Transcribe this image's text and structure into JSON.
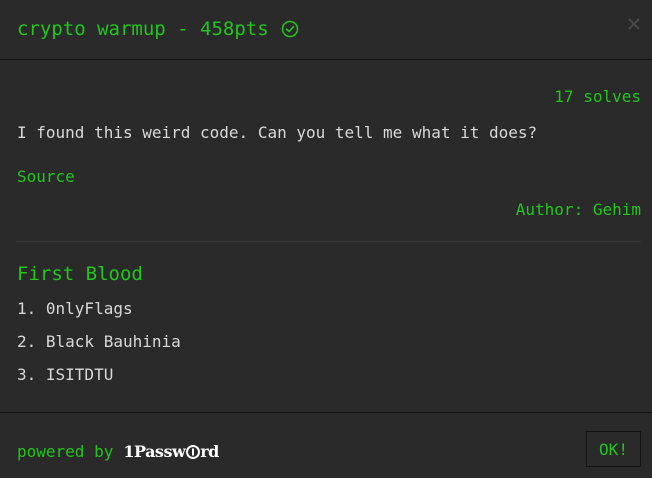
{
  "header": {
    "title": "crypto warmup - 458pts",
    "solved_icon": "check-circle-icon",
    "close_icon": "close-icon"
  },
  "body": {
    "solves": "17 solves",
    "description": "I found this weird code. Can you tell me what it does?",
    "source_link": "Source",
    "author": "Author: Gehim"
  },
  "first_blood": {
    "heading": "First Blood",
    "entries": [
      "1. 0nlyFlags",
      "2. Black Bauhinia",
      "3. ISITDTU"
    ]
  },
  "footer": {
    "powered_by": "powered by",
    "logo_text": "1Password",
    "ok_label": "OK!"
  },
  "colors": {
    "accent": "#22c51e",
    "background": "#2a2a2a",
    "text": "#d8d8d8",
    "border": "#141414"
  }
}
